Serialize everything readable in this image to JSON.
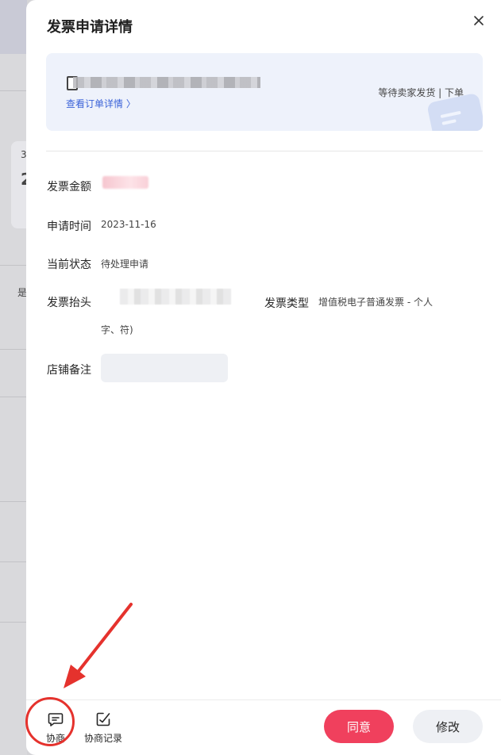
{
  "drawer": {
    "title": "发票申请详情",
    "close_icon": "close-icon"
  },
  "order": {
    "icon": "document-icon",
    "link_label": "查看订单详情 〉",
    "status": "等待卖家发货 | 下单"
  },
  "fields": {
    "amount_label": "发票金额",
    "apply_time_label": "申请时间",
    "apply_time_value": "2023-11-16",
    "status_label": "当前状态",
    "status_value": "待处理申请",
    "header_label": "发票抬头",
    "header_value_line2": "字、符)",
    "type_label": "发票类型",
    "type_value": "增值税电子普通发票 - 个人",
    "remark_label": "店铺备注"
  },
  "footer": {
    "negotiate_label": "协商",
    "negotiate_icon": "chat-icon",
    "record_label": "协商记录",
    "record_icon": "edit-record-icon",
    "agree_label": "同意",
    "modify_label": "修改"
  },
  "background": {
    "text_a": "3",
    "text_b": "2",
    "text_c": "是"
  },
  "colors": {
    "accent": "#f0405d",
    "link": "#3b63d8",
    "annotation": "#e5322d"
  }
}
